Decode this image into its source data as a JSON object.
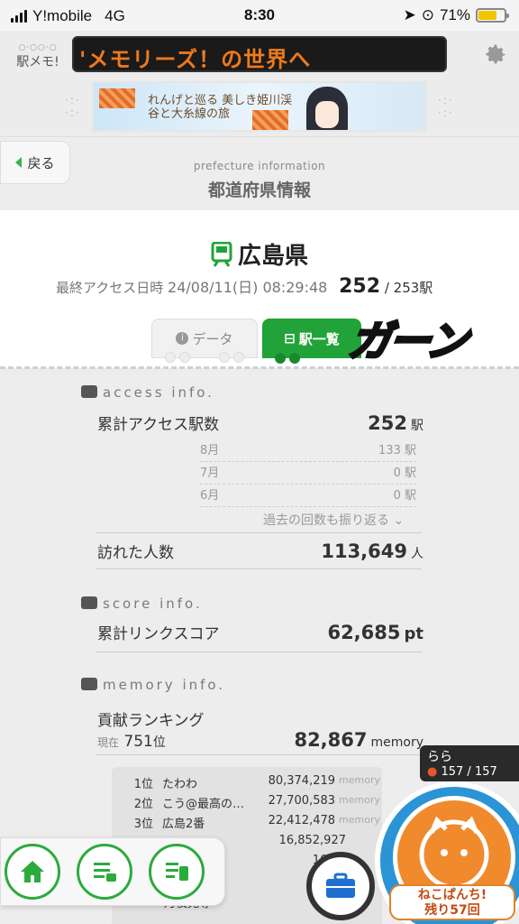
{
  "status": {
    "carrier": "Y!mobile",
    "network": "4G",
    "time": "8:30",
    "battery": "71%"
  },
  "app": {
    "logo": "駅メモ!",
    "ticker": "'メモリーズ！の世界へ",
    "banner_text": "れんげと巡る 美しき姫川渓谷と大糸線の旅"
  },
  "header": {
    "back": "戻る",
    "subtitle": "prefecture information",
    "title": "都道府県情報"
  },
  "prefecture": {
    "name": "広島県",
    "last_access_label": "最終アクセス日時",
    "last_access": "24/08/11(日) 08:29:48",
    "visited": "252",
    "total": "/ 253駅"
  },
  "tabs": {
    "data": "データ",
    "stations": "駅一覧",
    "overlay": "ガーン"
  },
  "access": {
    "heading": "access info.",
    "total_label": "累計アクセス駅数",
    "total_value": "252",
    "total_unit": "駅",
    "months": [
      {
        "label": "8月",
        "value": "133 駅"
      },
      {
        "label": "7月",
        "value": "0 駅"
      },
      {
        "label": "6月",
        "value": "0 駅"
      }
    ],
    "more": "過去の回数も振り返る",
    "visitors_label": "訪れた人数",
    "visitors_value": "113,649",
    "visitors_unit": "人"
  },
  "score": {
    "heading": "score info.",
    "label": "累計リンクスコア",
    "value": "62,685",
    "unit": "pt"
  },
  "memory": {
    "heading": "memory info.",
    "ranking_label": "貢献ランキング",
    "current_label": "現在",
    "current_rank": "751",
    "rank_unit": "位",
    "value": "82,867",
    "unit": "memory",
    "ranks": [
      {
        "pos": "1位",
        "name": "たわわ",
        "score": "80,374,219"
      },
      {
        "pos": "2位",
        "name": "こう@最高の…",
        "score": "27,700,583"
      },
      {
        "pos": "3位",
        "name": "広島2番",
        "score": "22,412,478"
      },
      {
        "pos": "",
        "name": "在)",
        "score": "16,852,927"
      },
      {
        "pos": "",
        "name": "好きの…",
        "score": "16,58"
      },
      {
        "pos": "",
        "name": "@大人…",
        "score": "14,8"
      },
      {
        "pos": "",
        "name": "月夜見尊",
        "score": "11,5"
      }
    ],
    "rank_unit_label": "memory"
  },
  "player": {
    "name": "らら",
    "hp": "157 / 157"
  },
  "neko": {
    "line1": "ねこぱんち!",
    "line2": "残り57回"
  }
}
